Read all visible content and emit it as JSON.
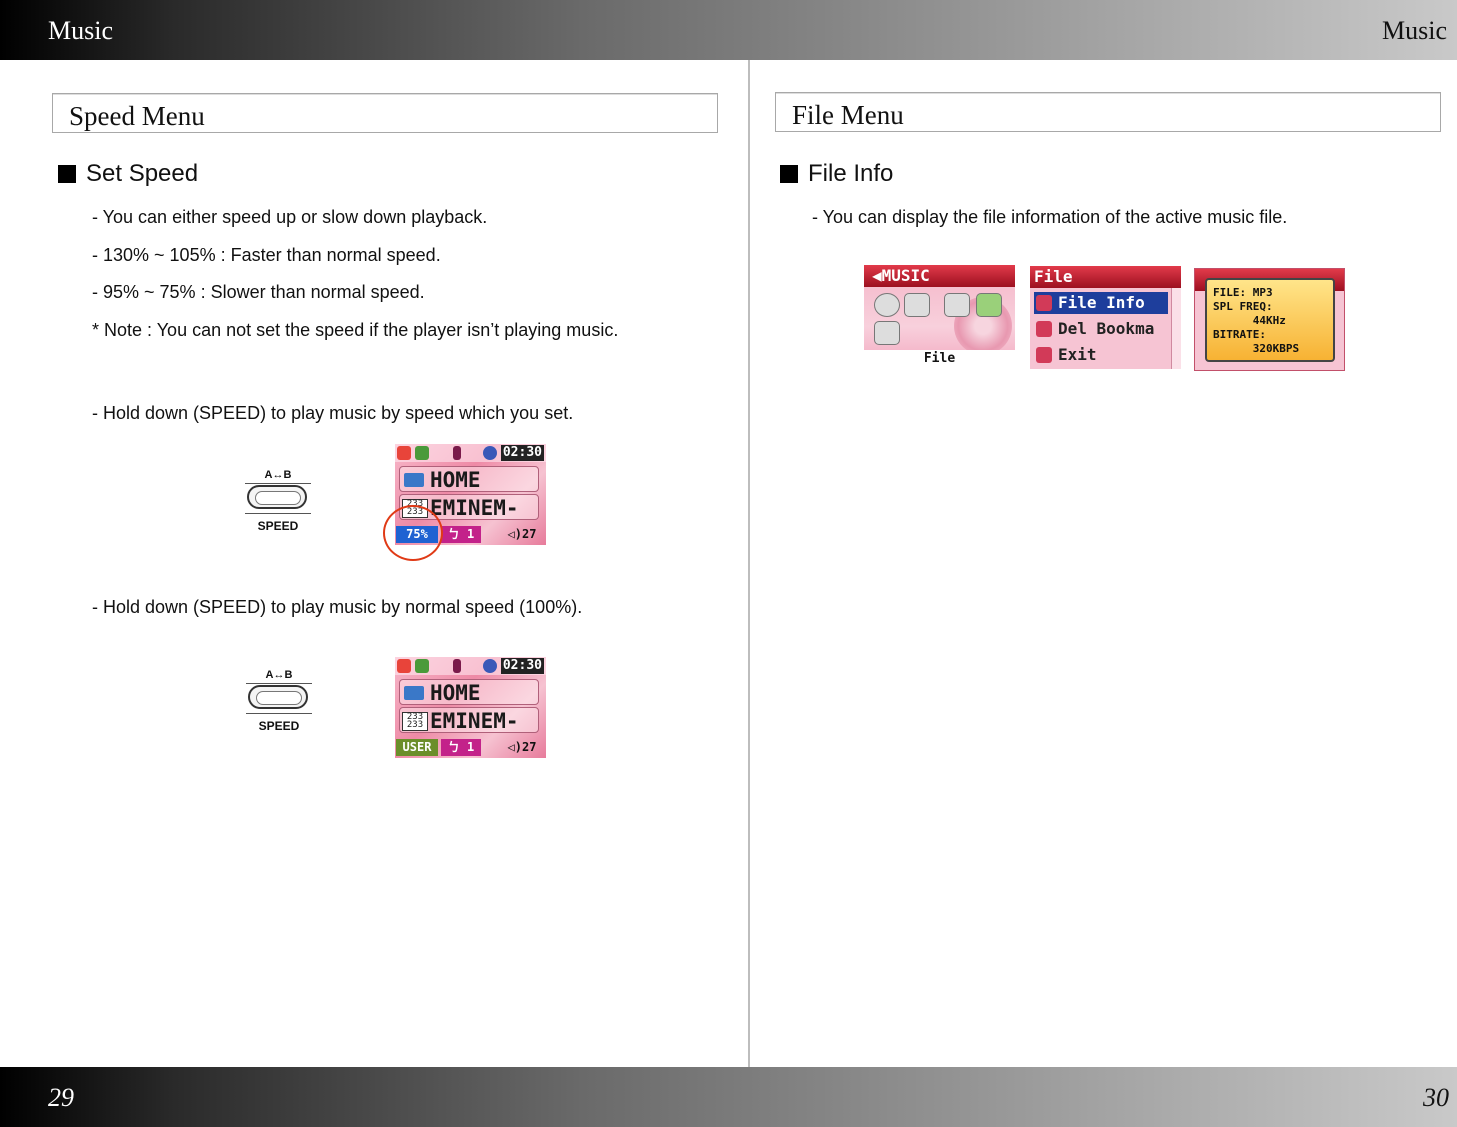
{
  "header": {
    "left_title": "Music",
    "right_title": "Music"
  },
  "footer": {
    "left_page": "29",
    "right_page": "30"
  },
  "left": {
    "section_title": "Speed Menu",
    "heading": "Set Speed",
    "lines": [
      "- You can either speed up or slow down playback.",
      "- 130% ~ 105% : Faster than normal speed.",
      "- 95% ~ 75% : Slower than normal speed.",
      "* Note : You can not set the speed if the player isn’t playing music."
    ],
    "hold_set": "- Hold down (SPEED) to play music by speed which you set.",
    "hold_normal": "- Hold down (SPEED) to play music by normal speed (100%).",
    "button": {
      "top_label": "A↔B",
      "bottom_label": "SPEED"
    },
    "screen1": {
      "time": "02:30",
      "row1": "HOME",
      "row2": "EMINEM-",
      "speed": "75%",
      "repeat": "ㄅ 1",
      "volume": "◁)27"
    },
    "screen2": {
      "time": "02:30",
      "row1": "HOME",
      "row2": "EMINEM-",
      "eq": "USER",
      "repeat": "ㄅ 1",
      "volume": "◁)27"
    }
  },
  "right": {
    "section_title": "File Menu",
    "heading": "File Info",
    "line": "- You can display the file information of the active music file.",
    "menu1": {
      "title": "◀MUSIC",
      "footer": "File"
    },
    "menu2": {
      "title": "File",
      "items": [
        "File Info",
        "Del Bookma",
        "Exit"
      ]
    },
    "menu3": {
      "popup": [
        "FILE: MP3",
        "SPL FREQ:",
        "      44KHz",
        "BITRATE:",
        "      320KBPS"
      ]
    }
  }
}
